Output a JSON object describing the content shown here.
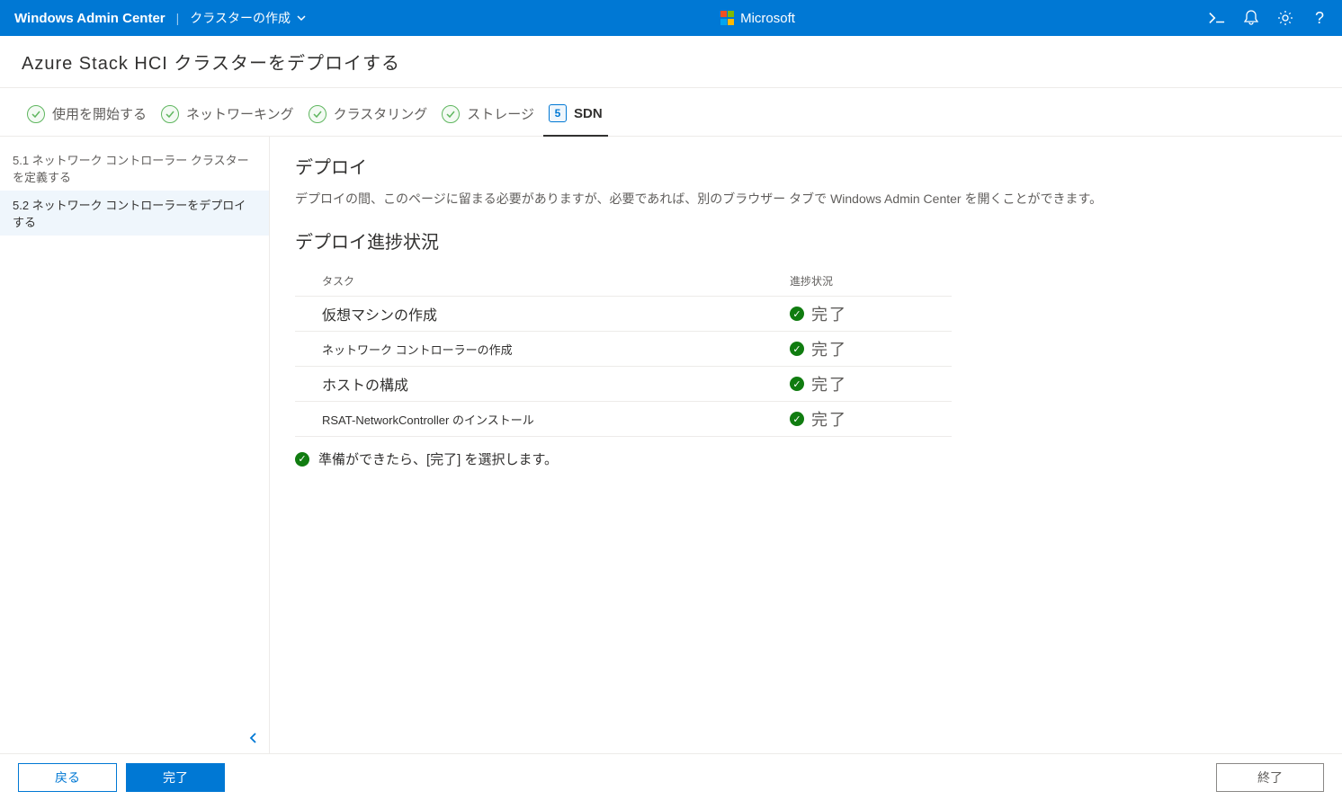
{
  "header": {
    "title": "Windows Admin Center",
    "subtitle": "クラスターの作成",
    "brand": "Microsoft"
  },
  "breadcrumb": "Azure Stack HCI クラスターをデプロイする",
  "steps": [
    {
      "label": "使用を開始する",
      "done": true
    },
    {
      "label": "ネットワーキング",
      "done": true
    },
    {
      "label": "クラスタリング",
      "done": true
    },
    {
      "label": "ストレージ",
      "done": true
    },
    {
      "label": "SDN",
      "num": "5",
      "active": true
    }
  ],
  "sidebar": {
    "items": [
      {
        "label": "5.1 ネットワーク コントローラー クラスターを定義する"
      },
      {
        "label": "5.2 ネットワーク コントローラーをデプロイする",
        "active": true
      }
    ]
  },
  "main": {
    "heading": "デプロイ",
    "description": "デプロイの間、このページに留まる必要がありますが、必要であれば、別のブラウザー タブで Windows Admin Center を開くことができます。",
    "progress_heading": "デプロイ進捗状況",
    "table": {
      "col_task": "タスク",
      "col_status": "進捗状況",
      "rows": [
        {
          "task": "仮想マシンの作成",
          "status": "完了",
          "level": "main"
        },
        {
          "task": "ネットワーク コントローラーの作成",
          "status": "完了",
          "level": "sub"
        },
        {
          "task": "ホストの構成",
          "status": "完了",
          "level": "main"
        },
        {
          "task": "RSAT-NetworkController のインストール",
          "status": "完了",
          "level": "sub"
        }
      ]
    },
    "ready_text": "準備ができたら、[完了] を選択します。"
  },
  "footer": {
    "back": "戻る",
    "finish": "完了",
    "exit": "終了"
  }
}
